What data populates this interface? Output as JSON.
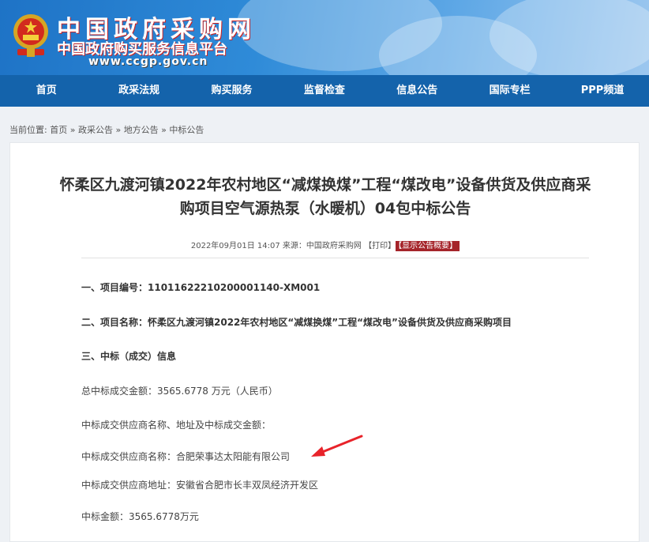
{
  "header": {
    "site_name": "中国政府采购网",
    "site_subtitle": "中国政府购买服务信息平台",
    "site_url": "www.ccgp.gov.cn"
  },
  "nav": {
    "items": [
      "首页",
      "政采法规",
      "购买服务",
      "监督检查",
      "信息公告",
      "国际专栏",
      "PPP频道"
    ]
  },
  "breadcrumb": {
    "prefix": "当前位置:",
    "items": [
      "首页",
      "政采公告",
      "地方公告",
      "中标公告"
    ]
  },
  "article": {
    "title_line1": "怀柔区九渡河镇2022年农村地区“减煤换煤”工程“煤改电”设备供货及供应商采",
    "title_line2": "购项目空气源热泵（水暖机）04包中标公告",
    "meta_text": "2022年09月01日 14:07 来源：中国政府采购网 【打印】",
    "meta_badge": "【显示公告概要】",
    "lines": {
      "project_no": "一、项目编号：11011622210200001140-XM001",
      "project_name": "二、项目名称：怀柔区九渡河镇2022年农村地区“减煤换煤”工程“煤改电”设备供货及供应商采购项目",
      "section3": "三、中标（成交）信息",
      "total": "总中标成交金额：3565.6778 万元（人民币）",
      "supplier_header": "中标成交供应商名称、地址及中标成交金额：",
      "supplier_name": "中标成交供应商名称：合肥荣事达太阳能有限公司",
      "supplier_addr": "中标成交供应商地址：安徽省合肥市长丰双凤经济开发区",
      "amount": "中标金额：3565.6778万元"
    }
  },
  "colors": {
    "nav_bg": "#1463ab",
    "badge_bg": "#a5242a",
    "arrow": "#e8232a"
  }
}
